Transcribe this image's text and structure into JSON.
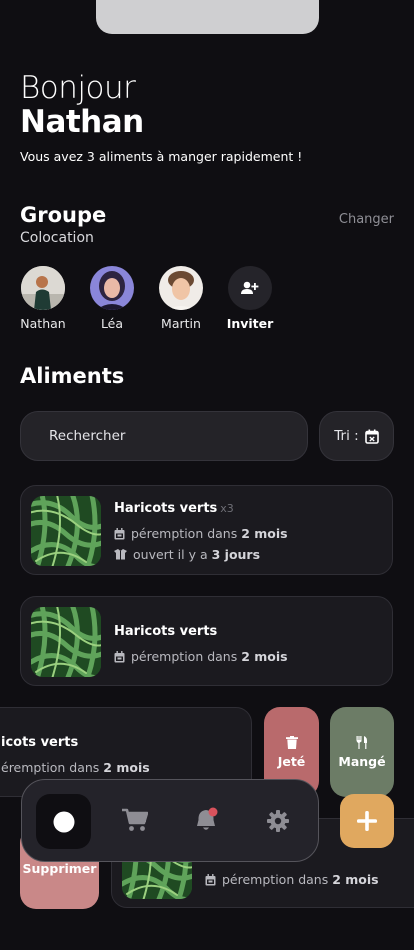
{
  "greeting": {
    "line1": "Bonjour",
    "name": "Nathan",
    "subtitle": "Vous avez 3 aliments à manger rapidement !"
  },
  "group": {
    "title": "Groupe",
    "subtitle": "Colocation",
    "change_label": "Changer",
    "members": [
      {
        "name": "Nathan"
      },
      {
        "name": "Léa"
      },
      {
        "name": "Martin"
      }
    ],
    "invite_label": "Inviter"
  },
  "foods": {
    "title": "Aliments",
    "search_placeholder": "Rechercher",
    "sort_label": "Tri :",
    "items": [
      {
        "name": "Haricots verts",
        "qty": "x3",
        "expiry_prefix": "péremption dans",
        "expiry_value": "2 mois",
        "opened_prefix": "ouvert il y a",
        "opened_value": "3 jours"
      },
      {
        "name": "Haricots verts",
        "expiry_prefix": "péremption dans",
        "expiry_value": "2 mois"
      },
      {
        "name": "icots verts",
        "expiry_prefix": "éremption dans",
        "expiry_value": "2 mois"
      },
      {
        "expiry_prefix": "péremption dans",
        "expiry_value": "2 mois"
      }
    ],
    "actions": {
      "thrown": "Jeté",
      "eaten": "Mangé",
      "delete": "Supprimer"
    }
  },
  "colors": {
    "background": "#0f0e12",
    "card": "#1b1a1f",
    "thrown": "#b96a6c",
    "eaten": "#6c7c66",
    "delete": "#c98888",
    "accent": "#e0a85f",
    "notification": "#d9525c"
  },
  "nav": {
    "items": [
      "home-icon",
      "cart-icon",
      "bell-icon",
      "gear-icon"
    ],
    "fab": "plus-icon"
  }
}
